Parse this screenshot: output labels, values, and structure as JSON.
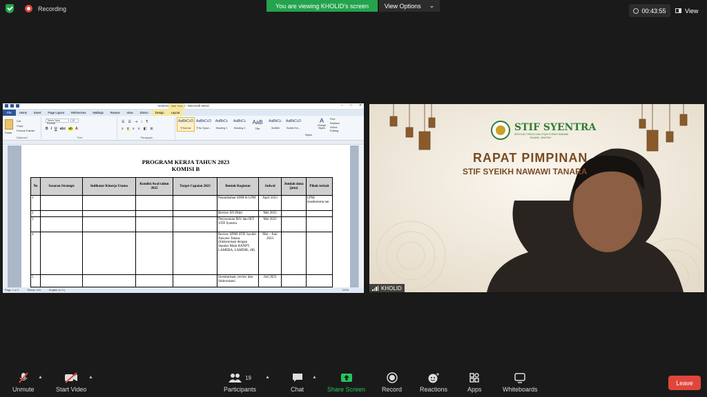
{
  "top": {
    "recording": "Recording",
    "viewing": "You are viewing KHOLID's screen",
    "view_options": "View Options",
    "timer": "00:43:55",
    "view": "View"
  },
  "word": {
    "title": "revisi-komisi B.docx - Microsoft Word",
    "tabs": [
      "File",
      "Home",
      "Insert",
      "Page Layout",
      "References",
      "Mailings",
      "Review",
      "View",
      "Zotero",
      "Design",
      "Layout"
    ],
    "context_tab": "Table Tools",
    "font": "Times New Roman",
    "size": "12",
    "clipboard": {
      "paste": "Paste",
      "cut": "Cut",
      "copy": "Copy",
      "format_painter": "Format Painter"
    },
    "groups": [
      "Clipboard",
      "Font",
      "Paragraph",
      "Styles",
      "Editing"
    ],
    "styles": [
      {
        "sample": "AaBbCcD",
        "name": "¶ Normal"
      },
      {
        "sample": "AaBbCcD",
        "name": "¶ No Spaci..."
      },
      {
        "sample": "AaBbCc",
        "name": "Heading 1"
      },
      {
        "sample": "AaBbCc",
        "name": "Heading 2"
      },
      {
        "sample": "AaB",
        "name": "Title"
      },
      {
        "sample": "AaBbCc.",
        "name": "Subtitle"
      },
      {
        "sample": "AaBbCcD",
        "name": "Subtle Em..."
      }
    ],
    "change_styles": "Change Styles",
    "editing": [
      "Find",
      "Replace",
      "Select"
    ],
    "status": [
      "Page: 1 of 2",
      "Words: 216",
      "English (U.S.)"
    ],
    "zoom": "110%",
    "doc_title_1": "PROGRAM KERJA TAHUN 2023",
    "doc_title_2": "KOMISI B",
    "headers": [
      "No",
      "Sasaran Strategis",
      "Indikator Kinerja Utama",
      "Kondisi Awal tahun 2022",
      "Target Capaian 2023",
      "Bentuk Kegiatan",
      "Jadwal",
      "Jumlah dana (juta)",
      "Pihak terkait"
    ],
    "rows": [
      {
        "no": "1",
        "kegiatan": "Penambahan SDM di LPM",
        "jadwal": "April 2023",
        "pihak": "LPM, kesekretaria tan"
      },
      {
        "no": "2",
        "kegiatan": "Review SN-Dikti",
        "jadwal": "Mei 2023",
        "pihak": ""
      },
      {
        "no": "3",
        "kegiatan": "Penyusunan IKU dan IKT STIF Syentra",
        "jadwal": "Mei 2023",
        "pihak": ""
      },
      {
        "no": "4",
        "kegiatan": "Review SPMI STIF Syeikh Nawawi Tanara (Sinkronisasi dengan Standar Mutu BANPT, LAMEBA, LAMDIK, dll)",
        "jadwal": "Mei – Juni 2023",
        "pihak": ""
      },
      {
        "no": "5",
        "kegiatan": "Inventarisasi, review dan Sinkronisasi",
        "jadwal": "Juli 2023",
        "pihak": ""
      }
    ]
  },
  "video": {
    "logo": "STIF SYENTRA",
    "logo_sub": "SEKOLAH TINGGI ILMU FIQIH SYEIKH NAWAWI",
    "logo_sub2": "TANARA - BANTEN",
    "banner1": "RAPAT PIMPINAN",
    "banner2": "STIF SYEIKH NAWAWI TANARA",
    "name": "KHOLID"
  },
  "toolbar": {
    "unmute": "Unmute",
    "start_video": "Start Video",
    "participants": "Participants",
    "participants_count": "19",
    "chat": "Chat",
    "share": "Share Screen",
    "record": "Record",
    "reactions": "Reactions",
    "apps": "Apps",
    "whiteboards": "Whiteboards",
    "leave": "Leave"
  },
  "colors": {
    "zoom_green": "#23a34c",
    "leave_red": "#e0463a",
    "word_blue": "#2b5797"
  }
}
